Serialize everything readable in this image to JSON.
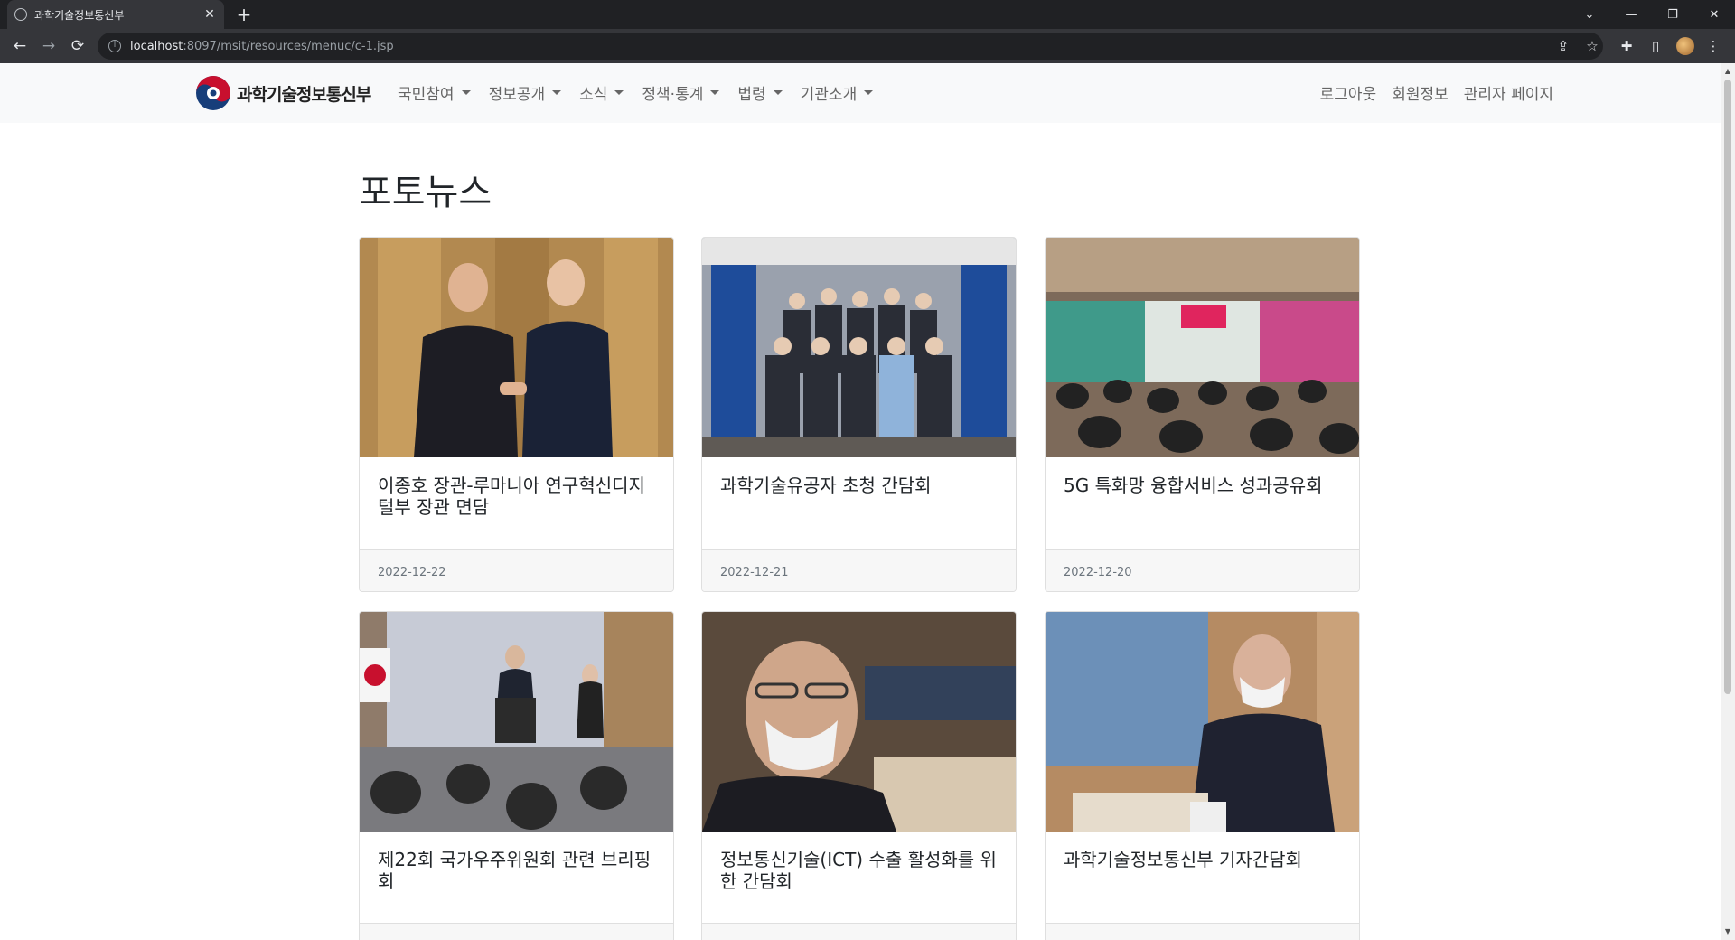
{
  "browser": {
    "tab_title": "과학기술정보통신부",
    "tab_close": "✕",
    "new_tab": "+",
    "url_host": "localhost",
    "url_rest": ":8097/msit/resources/menuc/c-1.jsp",
    "back": "←",
    "forward": "→",
    "reload": "⟳",
    "minimize": "—",
    "restore": "❐",
    "close": "✕",
    "tab_list": "⌄",
    "share": "⇪",
    "bookmark": "☆",
    "extensions": "✚",
    "sidepanel": "▯",
    "more": "⋮"
  },
  "site": {
    "brand": "과학기술정보통신부",
    "menu": [
      "국민참여",
      "정보공개",
      "소식",
      "정책·통계",
      "법령",
      "기관소개"
    ],
    "right_menu": [
      "로그아웃",
      "회원정보",
      "관리자 페이지"
    ]
  },
  "page": {
    "heading": "포토뉴스"
  },
  "cards": [
    {
      "title": "이종호 장관-루마니아 연구혁신디지털부 장관 면담",
      "date": "2022-12-22",
      "photo": "handshake-photo"
    },
    {
      "title": "과학기술유공자 초청 간담회",
      "date": "2022-12-21",
      "photo": "group-photo"
    },
    {
      "title": "5G 특화망 융합서비스 성과공유회",
      "date": "2022-12-20",
      "photo": "conference-photo"
    },
    {
      "title": "제22회 국가우주위원회 관련 브리핑회",
      "date": "",
      "photo": "briefing-photo"
    },
    {
      "title": "정보통신기술(ICT) 수출 활성화를 위한 간담회",
      "date": "",
      "photo": "meeting-photo"
    },
    {
      "title": "과학기술정보통신부 기자간담회",
      "date": "",
      "photo": "press-photo"
    }
  ],
  "colors": {
    "chrome_dark": "#202124",
    "chrome_toolbar": "#35363a",
    "navbar_bg": "#f8f9fa",
    "logo_blue": "#173e7a",
    "logo_red": "#c8102e"
  }
}
